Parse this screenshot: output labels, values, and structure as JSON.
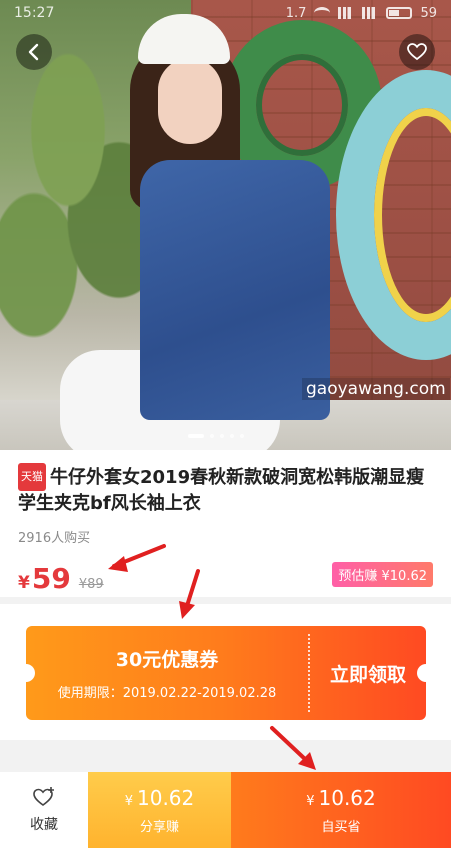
{
  "status_bar": {
    "time": "15:27",
    "net": "1.7",
    "battery": "59"
  },
  "hero": {
    "watermark": "gaoyawang.com",
    "slide_count": 5,
    "active_slide": 1
  },
  "icons": {
    "back": "chevron-left-icon",
    "favorite": "heart-icon",
    "collect": "heart-plus-icon"
  },
  "product": {
    "badge": "天猫",
    "title": "牛仔外套女2019春秋新款破洞宽松韩版潮显瘦学生夹克bf风长袖上衣",
    "sales": "2916人购买",
    "currency": "¥",
    "price": "59",
    "original_price": "¥89",
    "estimated_earn": "预估赚 ¥10.62"
  },
  "coupon": {
    "amount": "30元优惠券",
    "validity": "使用期限：2019.02.22-2019.02.28",
    "cta": "立即领取"
  },
  "bottom_bar": {
    "collect_label": "收藏",
    "share_currency": "¥",
    "share_value": "10.62",
    "share_label": "分享赚",
    "buy_currency": "¥",
    "buy_value": "10.62",
    "buy_label": "自买省"
  },
  "colors": {
    "accent_red": "#e4393c",
    "coupon_orange": "#ff7b1c",
    "share_yellow": "#ffbf3c",
    "arrow_red": "#e02020"
  }
}
